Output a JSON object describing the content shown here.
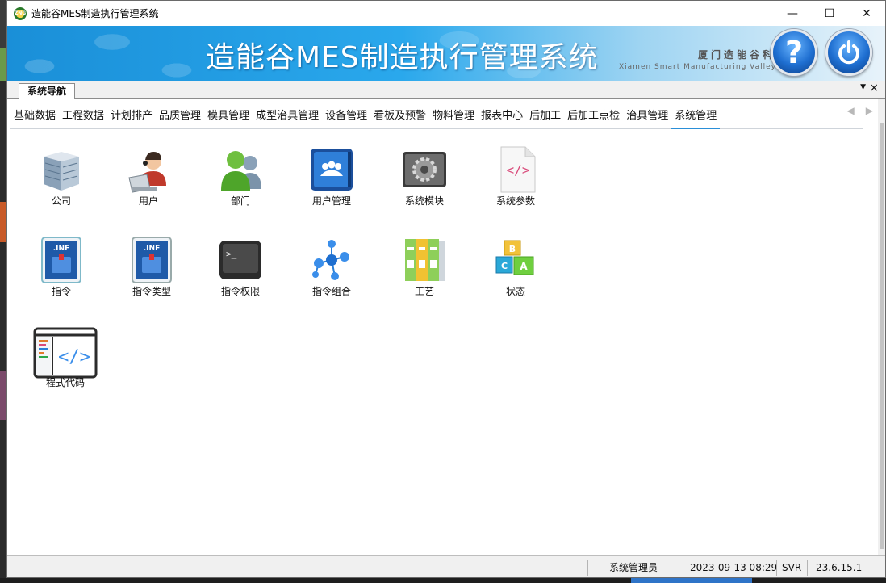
{
  "window": {
    "title": "造能谷MES制造执行管理系统",
    "controls": {
      "minimize": "—",
      "maximize": "☐",
      "close": "✕"
    }
  },
  "banner": {
    "title": "造能谷MES制造执行管理系统",
    "company_cn": "厦门造能谷科",
    "company_en": "Xiamen Smart Manufacturing Valley Techn",
    "help_label": "?"
  },
  "nav_tab": {
    "label": "系统导航"
  },
  "menu_tabs": [
    {
      "label": "基础数据"
    },
    {
      "label": "工程数据"
    },
    {
      "label": "计划排产"
    },
    {
      "label": "品质管理"
    },
    {
      "label": "模具管理"
    },
    {
      "label": "成型治具管理"
    },
    {
      "label": "设备管理"
    },
    {
      "label": "看板及预警"
    },
    {
      "label": "物料管理"
    },
    {
      "label": "报表中心"
    },
    {
      "label": "后加工"
    },
    {
      "label": "后加工点检"
    },
    {
      "label": "治具管理"
    },
    {
      "label": "系统管理"
    }
  ],
  "active_menu_tab": "系统管理",
  "tiles": [
    {
      "label": "公司",
      "icon": "building-icon"
    },
    {
      "label": "用户",
      "icon": "user-laptop-icon"
    },
    {
      "label": "部门",
      "icon": "department-people-icon"
    },
    {
      "label": "用户管理",
      "icon": "user-management-icon"
    },
    {
      "label": "系统模块",
      "icon": "gear-module-icon"
    },
    {
      "label": "系统参数",
      "icon": "code-document-icon"
    },
    {
      "label": "指令",
      "icon": "inf-file-icon"
    },
    {
      "label": "指令类型",
      "icon": "inf-file-type-icon"
    },
    {
      "label": "指令权限",
      "icon": "terminal-icon"
    },
    {
      "label": "指令组合",
      "icon": "molecule-icon"
    },
    {
      "label": "工艺",
      "icon": "binders-icon"
    },
    {
      "label": "状态",
      "icon": "abc-blocks-icon"
    },
    {
      "label": "程式代码",
      "icon": "code-editor-icon"
    }
  ],
  "statusbar": {
    "user": "系统管理员",
    "datetime": "2023-09-13 08:29",
    "server": "SVR",
    "version": "23.6.15.1"
  },
  "colors": {
    "accent": "#2a8fd8",
    "banner_left": "#1a8fd8",
    "banner_right": "#e8f3fa"
  }
}
